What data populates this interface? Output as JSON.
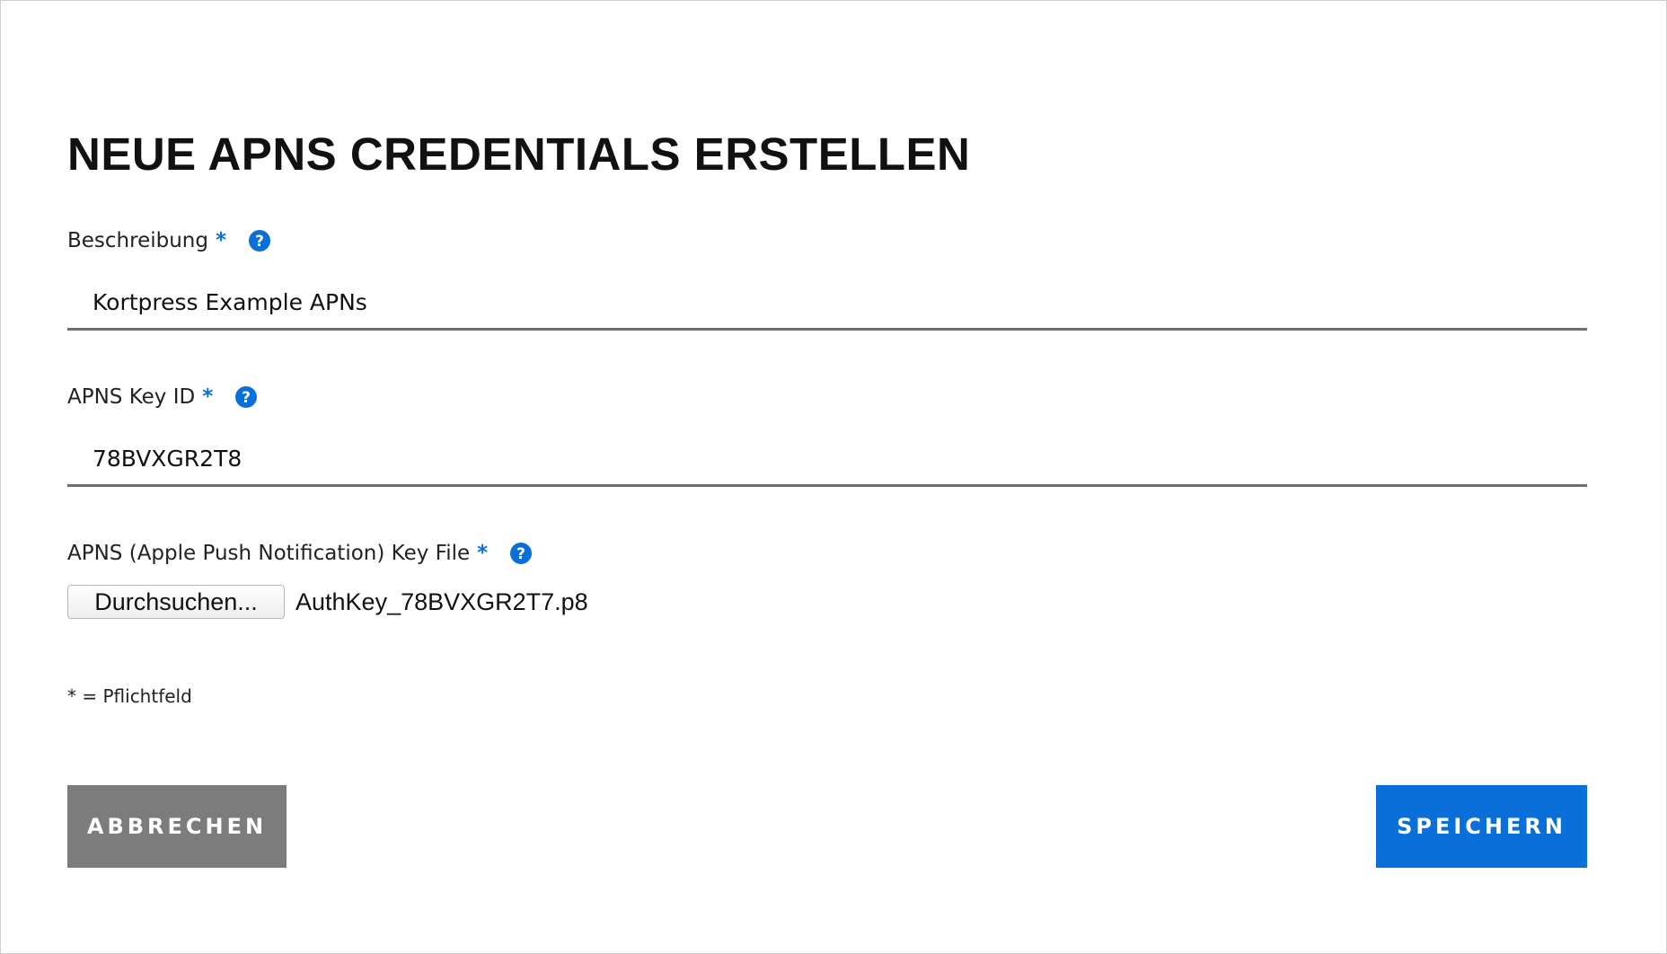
{
  "dialog": {
    "title": "NEUE APNS CREDENTIALS ERSTELLEN"
  },
  "fields": {
    "description": {
      "label": "Beschreibung",
      "required_marker": "*",
      "value": "Kortpress Example APNs"
    },
    "key_id": {
      "label": "APNS Key ID",
      "required_marker": "*",
      "value": "78BVXGR2T8"
    },
    "key_file": {
      "label": "APNS (Apple Push Notification) Key File",
      "required_marker": "*",
      "browse_label": "Durchsuchen...",
      "file_name": "AuthKey_78BVXGR2T7.p8"
    }
  },
  "required_note": "* = Pflichtfeld",
  "buttons": {
    "cancel": "ABBRECHEN",
    "save": "SPEICHERN"
  },
  "icons": {
    "help": "question-circle-icon"
  },
  "colors": {
    "accent": "#0a6fd8",
    "cancel_bg": "#7c7c7c",
    "input_underline": "#6e6e6e",
    "text": "#111111"
  }
}
